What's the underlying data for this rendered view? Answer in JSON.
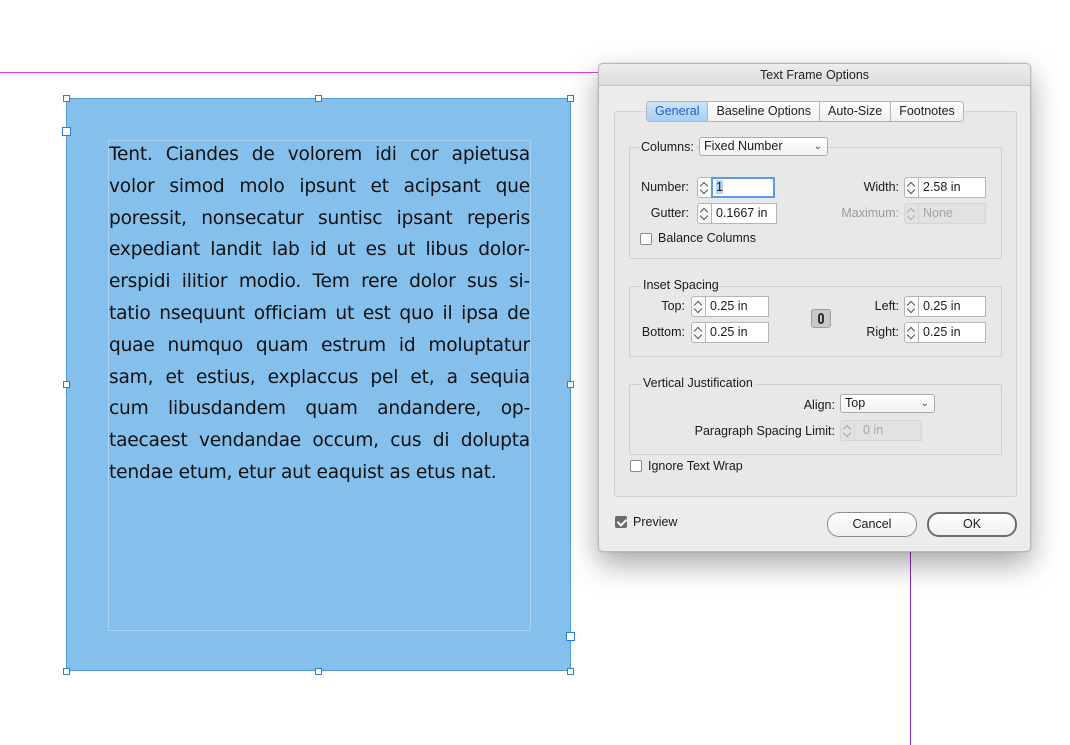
{
  "document": {
    "text_lines": [
      "Tent. Ciandes de volorem idi cor apietusa",
      "volor simod molo ipsunt et acipsant que",
      "poressit, nonsecatur suntisc ipsant reperis",
      "expediant landit lab id ut es ut libus dolor-",
      "erspidi ilitior modio. Tem rere dolor sus si-",
      "tatio nsequunt officiam ut est quo il ipsa de",
      "quae numquo quam estrum id moluptatur",
      "sam, et estius, explaccus pel et, a sequia",
      "cum libusdandem quam andandere, op-",
      "taecaest vendandae occum, cus di dolupta",
      "tendae etum, etur aut eaquist as etus nat."
    ],
    "frame_color": "#85c0ec",
    "guide_color": "#e23be0"
  },
  "dialog": {
    "title": "Text Frame Options",
    "tabs": [
      {
        "label": "General",
        "active": true
      },
      {
        "label": "Baseline Options",
        "active": false
      },
      {
        "label": "Auto-Size",
        "active": false
      },
      {
        "label": "Footnotes",
        "active": false
      }
    ],
    "columns": {
      "label": "Columns:",
      "type_value": "Fixed Number",
      "number_label": "Number:",
      "number_value": "1",
      "width_label": "Width:",
      "width_value": "2.58 in",
      "gutter_label": "Gutter:",
      "gutter_value": "0.1667 in",
      "maximum_label": "Maximum:",
      "maximum_value": "None",
      "balance_label": "Balance Columns",
      "balance_checked": false
    },
    "inset": {
      "title": "Inset Spacing",
      "top_label": "Top:",
      "top_value": "0.25 in",
      "bottom_label": "Bottom:",
      "bottom_value": "0.25 in",
      "left_label": "Left:",
      "left_value": "0.25 in",
      "right_label": "Right:",
      "right_value": "0.25 in"
    },
    "vertical": {
      "title": "Vertical Justification",
      "align_label": "Align:",
      "align_value": "Top",
      "spacing_label": "Paragraph Spacing Limit:",
      "spacing_value": "0 in"
    },
    "ignore_wrap_label": "Ignore Text Wrap",
    "ignore_wrap_checked": false,
    "preview_label": "Preview",
    "preview_checked": true,
    "cancel_label": "Cancel",
    "ok_label": "OK"
  }
}
